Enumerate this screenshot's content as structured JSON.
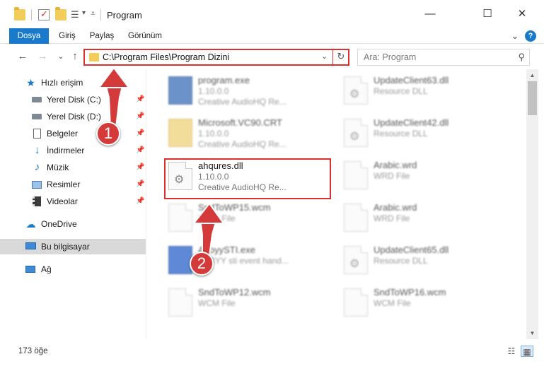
{
  "window": {
    "title": "Program",
    "controls": {
      "minimize": "—",
      "maximize": "☐",
      "close": "✕"
    }
  },
  "ribbon": {
    "tabs": [
      "Dosya",
      "Giriş",
      "Paylaş",
      "Görünüm"
    ],
    "expand_icon": "chevron-down-icon",
    "help_icon": "help-icon"
  },
  "navigation": {
    "back": "←",
    "forward": "→",
    "recent": "⌄",
    "up": "↑",
    "address": "C:\\Program Files\\Program Dizini",
    "search_placeholder": "Ara: Program"
  },
  "sidebar": {
    "quick_access": "Hızlı erişim",
    "items": [
      {
        "label": "Yerel Disk (C:)",
        "icon": "drive-icon",
        "pinned": true
      },
      {
        "label": "Yerel Disk (D:)",
        "icon": "drive-icon",
        "pinned": true
      },
      {
        "label": "Belgeler",
        "icon": "documents-icon",
        "pinned": true
      },
      {
        "label": "İndirmeler",
        "icon": "downloads-icon",
        "pinned": true
      },
      {
        "label": "Müzik",
        "icon": "music-icon",
        "pinned": true
      },
      {
        "label": "Resimler",
        "icon": "pictures-icon",
        "pinned": true
      },
      {
        "label": "Videolar",
        "icon": "videos-icon",
        "pinned": true
      }
    ],
    "onedrive": "OneDrive",
    "this_pc": "Bu bilgisayar",
    "network": "Ağ"
  },
  "files": [
    {
      "name": "program.exe",
      "version": "1.10.0.0",
      "desc": "Creative AudioHQ Re...",
      "icon": "exe-icon"
    },
    {
      "name": "UpdateClient63.dll",
      "version": "",
      "desc": "Resource DLL",
      "icon": "dll-icon"
    },
    {
      "name": "Microsoft.VC90.CRT",
      "version": "1.10.0.0",
      "desc": "Creative AudioHQ Re...",
      "icon": "folder-icon"
    },
    {
      "name": "UpdateClient42.dll",
      "version": "",
      "desc": "Resource DLL",
      "icon": "dll-icon"
    },
    {
      "name": "ahqures.dll",
      "version": "1.10.0.0",
      "desc": "Creative AudioHQ Re...",
      "icon": "dll-icon"
    },
    {
      "name": "Arabic.wrd",
      "version": "",
      "desc": "WRD File",
      "icon": "file-icon"
    },
    {
      "name": "SndToWP15.wcm",
      "version": "",
      "desc": "WCM File",
      "icon": "file-icon"
    },
    {
      "name": "Arabic.wrd",
      "version": "",
      "desc": "WRD File",
      "icon": "file-icon"
    },
    {
      "name": "AbbyySTI.exe",
      "version": "",
      "desc": "ABBYY sti event hand...",
      "icon": "app-icon"
    },
    {
      "name": "UpdateClient65.dll",
      "version": "",
      "desc": "Resource DLL",
      "icon": "dll-icon"
    },
    {
      "name": "SndToWP12.wcm",
      "version": "",
      "desc": "WCM File",
      "icon": "file-icon"
    },
    {
      "name": "SndToWP16.wcm",
      "version": "",
      "desc": "WCM File",
      "icon": "file-icon"
    }
  ],
  "status": {
    "count": "173 öğe"
  },
  "annotations": {
    "step1": "1",
    "step2": "2",
    "highlight_color": "#dc3030"
  },
  "colors": {
    "accent": "#1979ca",
    "selection": "#d9d9d9"
  }
}
